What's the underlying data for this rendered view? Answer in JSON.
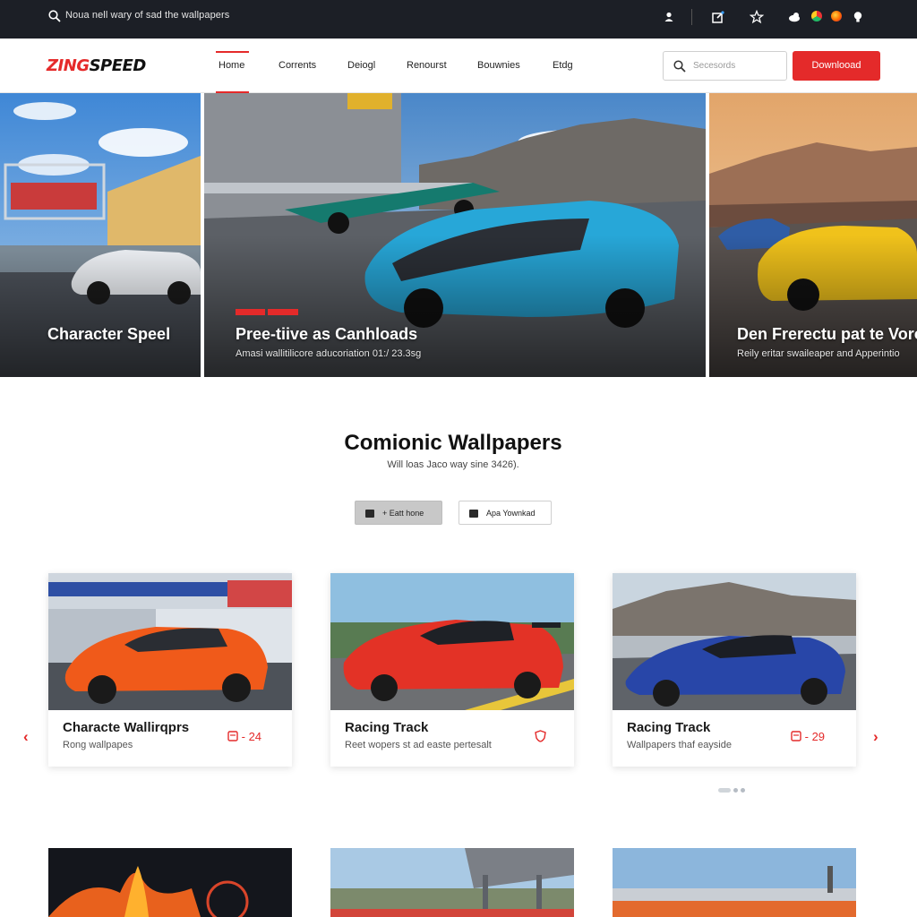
{
  "topbar": {
    "address": "Noua nell wary of sad the wallpapers",
    "icons": [
      "user-icon",
      "edit-icon",
      "star-icon",
      "cloud-icon",
      "chrome-icon",
      "firefox-icon",
      "bulb-icon"
    ]
  },
  "header": {
    "logo_red": "ZING",
    "logo_dark": "SPEED",
    "nav": [
      "Home",
      "Corrents",
      "Deiogl",
      "Renourst",
      "Bouwnies",
      "Etdg"
    ],
    "active_nav": "Home",
    "search_placeholder": "Secesords",
    "download_label": "Downlooad",
    "accent": "#e42a2a"
  },
  "hero": {
    "left": {
      "title": "Character Speel"
    },
    "center": {
      "title": "Pree-tiive as Canhloads",
      "sub": "Amasi wallitilicore aducoriation 01:/ 23.3sg"
    },
    "right": {
      "title": "Den Frerectu pat te Voro",
      "sub": "Reily eritar swaileaper and Apperintio"
    }
  },
  "section": {
    "title": "Comionic Wallpapers",
    "subtitle": "Will loas Jaco way sine 3426).",
    "btn_1": "+ Eatt hone",
    "btn_2": "Apa Yownkad"
  },
  "cards": [
    {
      "title": "Characte Wallirqprs",
      "sub": "Rong wallpapes",
      "meta": "- 24"
    },
    {
      "title": "Racing Track",
      "sub": "Reet wopers st ad easte pertesalt",
      "meta": ""
    },
    {
      "title": "Racing Track",
      "sub": "Wallpapers thaf eayside",
      "meta": "- 29"
    }
  ],
  "carousel": {
    "prev": "‹",
    "next": "›"
  }
}
